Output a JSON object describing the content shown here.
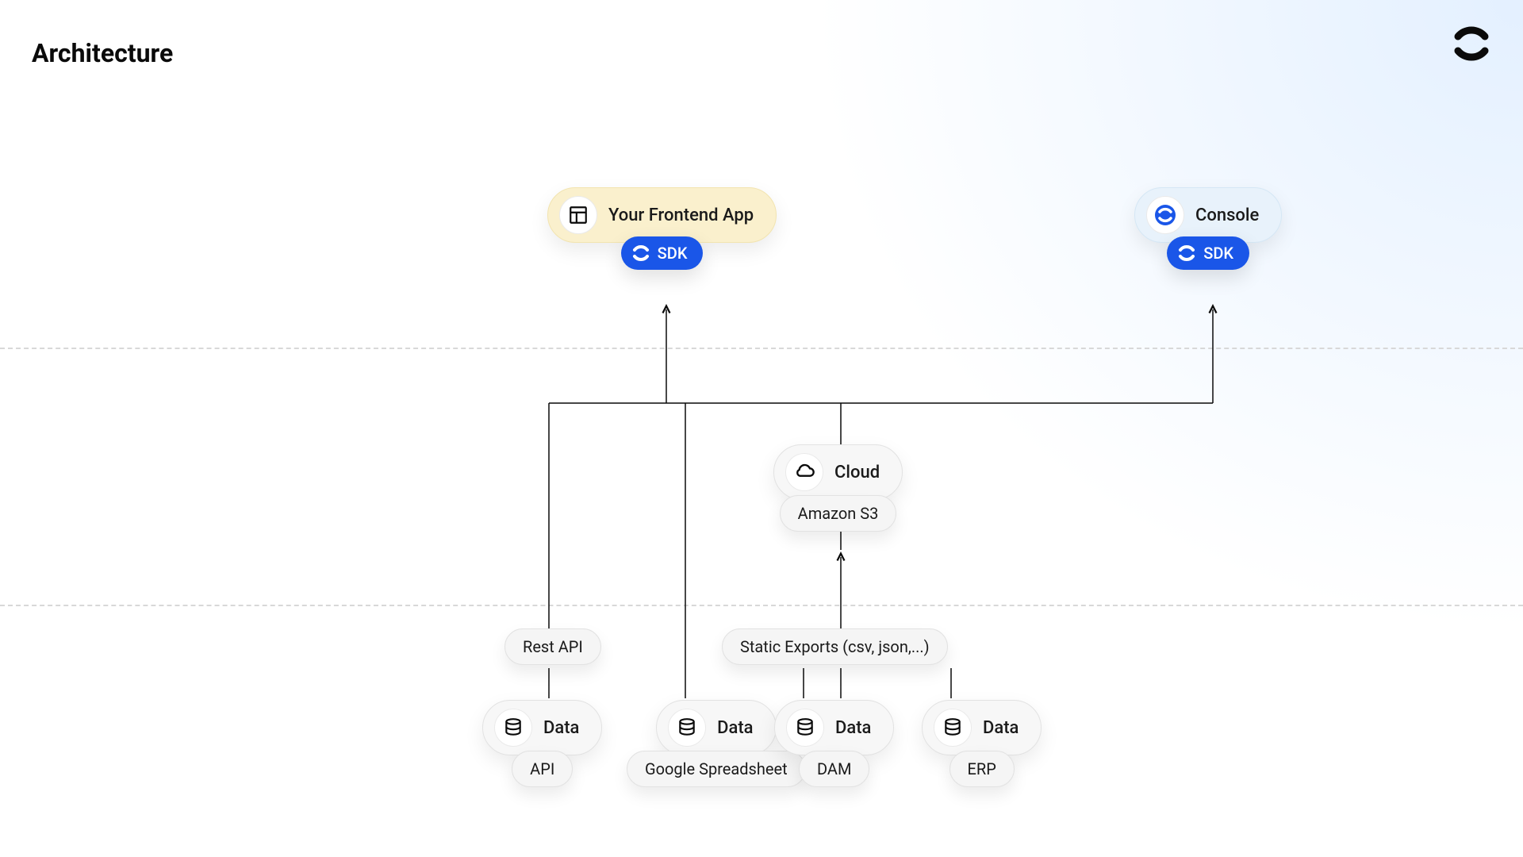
{
  "title": "Architecture",
  "top": {
    "frontend": {
      "label": "Your Frontend App",
      "sdk": "SDK"
    },
    "console": {
      "label": "Console",
      "sdk": "SDK"
    }
  },
  "middle": {
    "cloud": {
      "label": "Cloud",
      "sub": "Amazon S3"
    }
  },
  "connectors": {
    "restapi": "Rest API",
    "static": "Static Exports (csv, json,...)"
  },
  "sources": [
    {
      "label": "Data",
      "sub": "API"
    },
    {
      "label": "Data",
      "sub": "Google Spreadsheet"
    },
    {
      "label": "Data",
      "sub": "DAM"
    },
    {
      "label": "Data",
      "sub": "ERP"
    }
  ]
}
